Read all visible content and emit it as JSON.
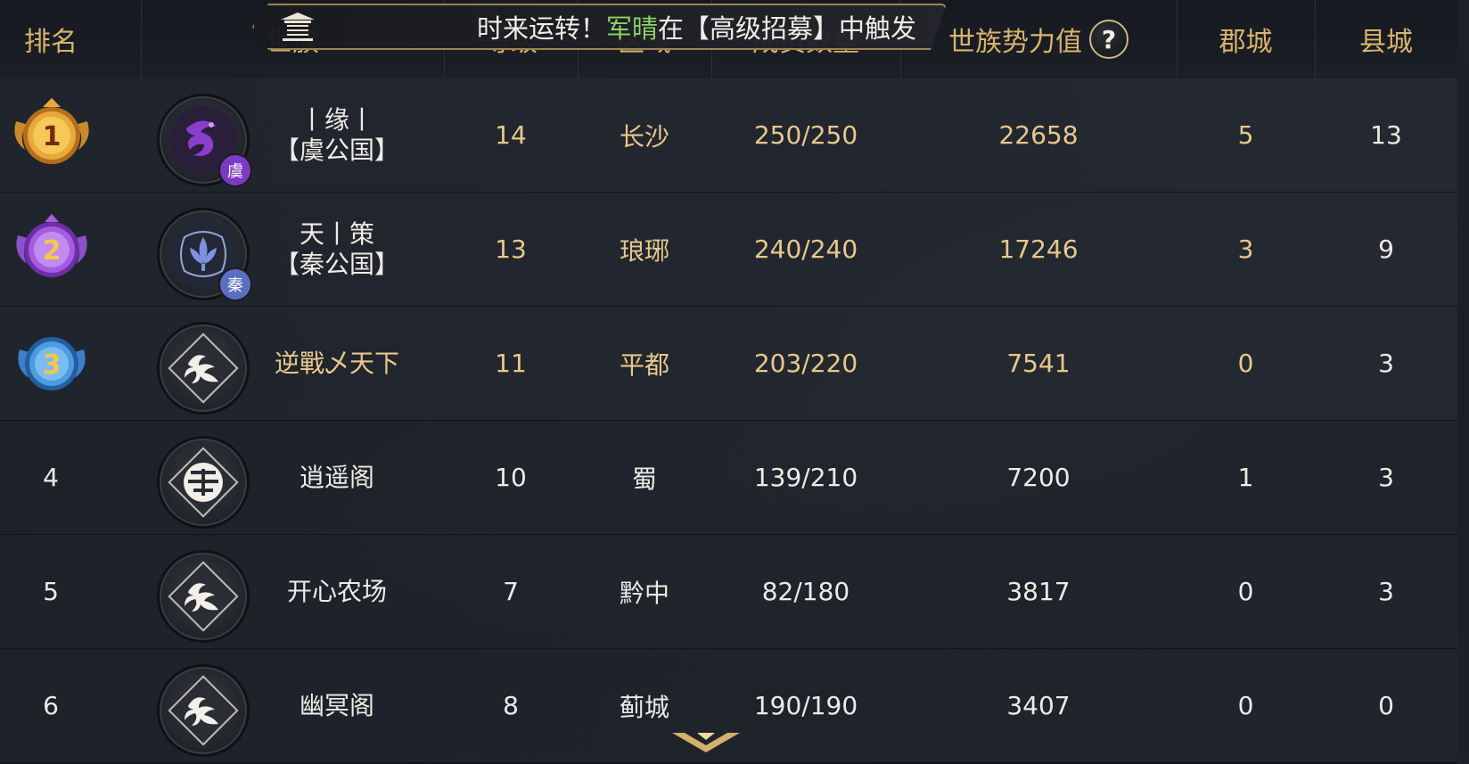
{
  "header": {
    "columns": [
      "排名",
      "世族",
      "等级",
      "区域",
      "成员数量",
      "世族势力值",
      "郡城",
      "县城"
    ],
    "help_label": "?"
  },
  "banner": {
    "prefix": "时来运转！",
    "highlight": "军晴",
    "suffix": "在【高级招募】中触发"
  },
  "rows": [
    {
      "rank": "1",
      "name_line1": "丨缘丨",
      "name_line2": "【虞公国】",
      "level": "14",
      "region": "长沙",
      "members": "250/250",
      "power": "22658",
      "prefecture": "5",
      "county": "13",
      "emblem_tag": "虞",
      "emblem": "dragon-emblem"
    },
    {
      "rank": "2",
      "name_line1": "天丨策",
      "name_line2": "【秦公国】",
      "level": "13",
      "region": "琅琊",
      "members": "240/240",
      "power": "17246",
      "prefecture": "3",
      "county": "9",
      "emblem_tag": "秦",
      "emblem": "lotus-emblem"
    },
    {
      "rank": "3",
      "name_line1": "逆戰乄天下",
      "level": "11",
      "region": "平都",
      "members": "203/220",
      "power": "7541",
      "prefecture": "0",
      "county": "3",
      "emblem": "swirl-emblem"
    },
    {
      "rank": "4",
      "name_line1": "逍遥阁",
      "level": "10",
      "region": "蜀",
      "members": "139/210",
      "power": "7200",
      "prefecture": "1",
      "county": "3",
      "emblem": "longevity-emblem"
    },
    {
      "rank": "5",
      "name_line1": "开心农场",
      "level": "7",
      "region": "黔中",
      "members": "82/180",
      "power": "3817",
      "prefecture": "0",
      "county": "3",
      "emblem": "swirl-emblem"
    },
    {
      "rank": "6",
      "name_line1": "幽冥阁",
      "level": "8",
      "region": "蓟城",
      "members": "190/190",
      "power": "3407",
      "prefecture": "0",
      "county": "0",
      "emblem": "swirl-emblem"
    }
  ],
  "colors": {
    "header_gold": "#d9b46d",
    "top_value_gold": "#e8c88c",
    "highlight_green": "#8ed16b",
    "medal_gold": "#e2a93a",
    "medal_purple": "#9b4fd0",
    "medal_blue": "#3d8fd8"
  }
}
